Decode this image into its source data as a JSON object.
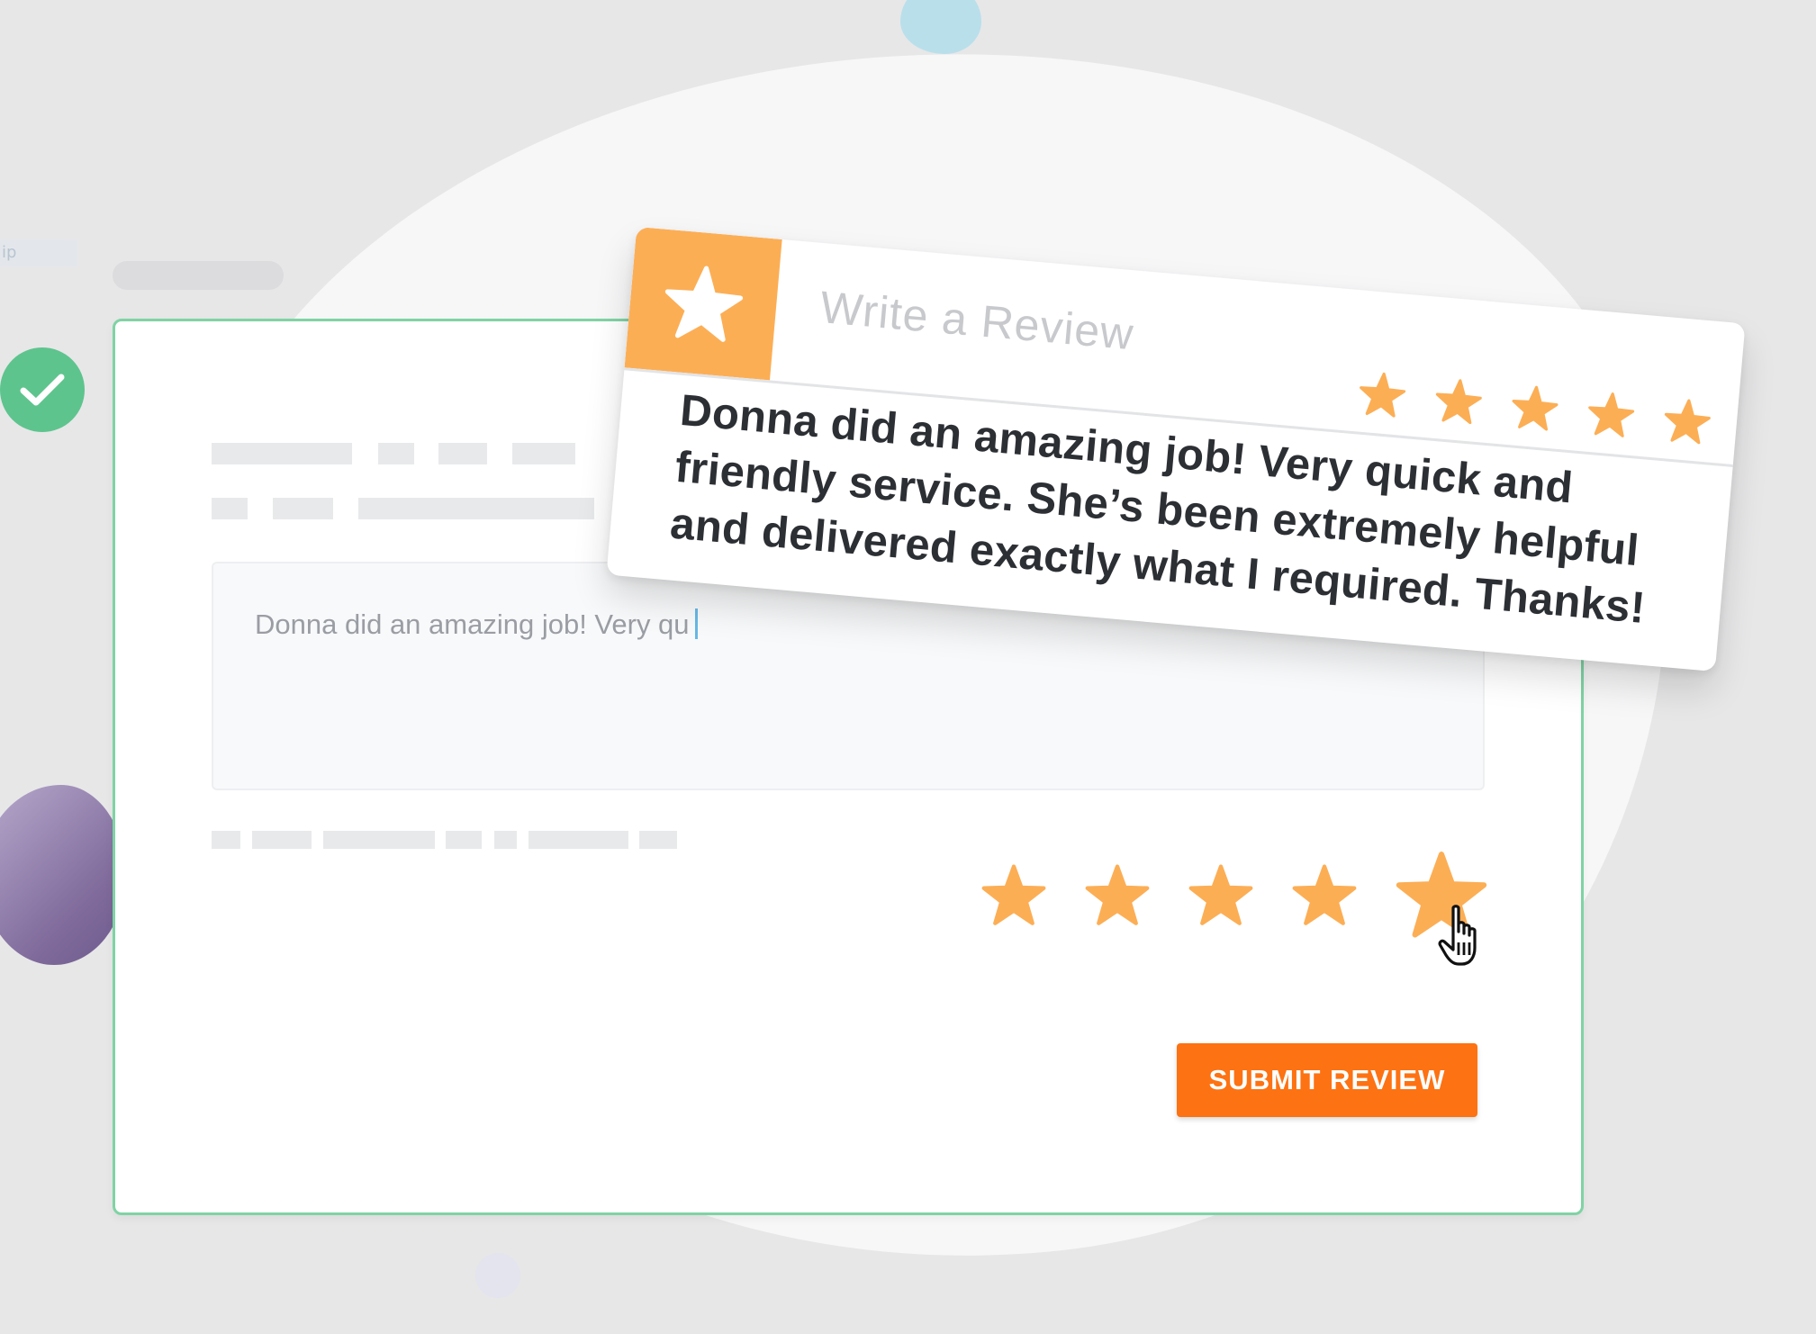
{
  "colors": {
    "accent_orange": "#fd7212",
    "star_orange": "#fcae55",
    "success_green": "#5dc48d",
    "card_border": "#7fd3a4"
  },
  "sidebar": {
    "tag_fragment": "ip"
  },
  "status": {
    "icon": "check-icon"
  },
  "form": {
    "review_input_value": "Donna did an amazing job! Very qu",
    "rating": {
      "value": 5,
      "max": 5,
      "icon": "star-icon"
    },
    "submit_label": "SUBMIT REVIEW",
    "cursor_icon": "hand-pointer-icon"
  },
  "review_popup": {
    "badge_icon": "star-icon",
    "title": "Write a Review",
    "rating": {
      "value": 5,
      "max": 5
    },
    "text": "Donna did an amazing job! Very quick and friendly service. She’s been extremely helpful and delivered exactly what I required. Thanks!"
  }
}
